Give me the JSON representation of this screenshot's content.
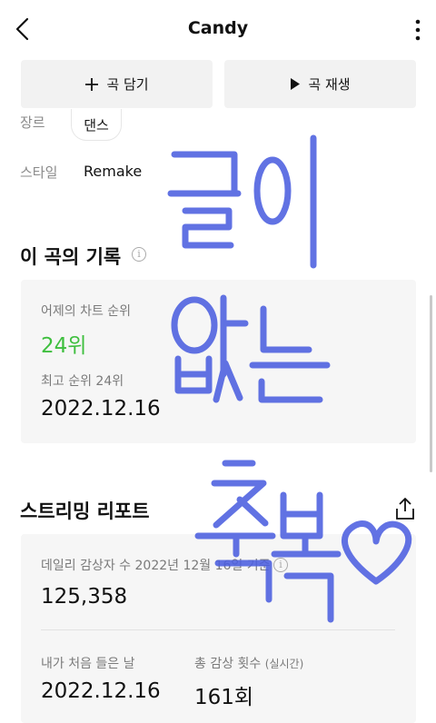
{
  "header": {
    "title": "Candy"
  },
  "actions": {
    "add_label": "곡 담기",
    "play_label": "곡 재생"
  },
  "song_info": {
    "genre_label": "장르",
    "genre_value": "댄스",
    "style_label": "스타일",
    "style_value": "Remake"
  },
  "record": {
    "title": "이 곡의 기록",
    "yesterday_label": "어제의 차트 순위",
    "yesterday_value": "24위",
    "best_label": "최고 순위 24위",
    "best_date": "2022.12.16"
  },
  "streaming": {
    "title": "스트리밍 리포트",
    "daily_label": "데일리 감상자 수 2022년 12월 16일 기준",
    "daily_value": "125,358",
    "first_label": "내가 처음 들은 날",
    "first_value": "2022.12.16",
    "total_label": "총 감상 횟수",
    "total_sub": "(실시간)",
    "total_value": "161회"
  },
  "overlay": {
    "handwriting": "끝이 없는 축복♡",
    "color": "#4c5fe0"
  }
}
